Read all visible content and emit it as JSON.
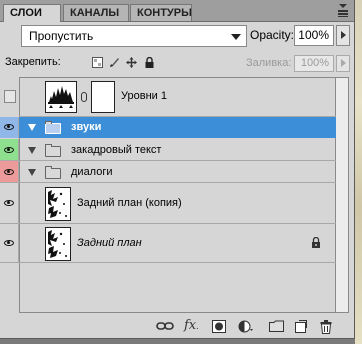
{
  "tabs": [
    {
      "label": "СЛОИ",
      "active": true
    },
    {
      "label": "КАНАЛЫ",
      "active": false
    },
    {
      "label": "КОНТУРЫ",
      "active": false
    }
  ],
  "blend": {
    "mode": "Пропустить",
    "opacity_label": "Opacity:",
    "opacity_value": "100%"
  },
  "lock": {
    "label": "Закрепить:",
    "fill_label": "Заливка:",
    "fill_value": "100%"
  },
  "layers": [
    {
      "name": "Уровни 1",
      "type": "adjustment",
      "visible": false
    },
    {
      "name": "звуки",
      "type": "group",
      "visible": true,
      "selected": true,
      "color": "#8fb8e8"
    },
    {
      "name": "закадровый текст",
      "type": "group",
      "visible": true,
      "color": "#8ee08e"
    },
    {
      "name": "диалоги",
      "type": "group",
      "visible": true,
      "color": "#ec9a9a"
    },
    {
      "name": "Задний план (копия)",
      "type": "image",
      "visible": true
    },
    {
      "name": "Задний план",
      "type": "background",
      "visible": true,
      "locked": true
    }
  ],
  "colors": {
    "selection": "#3c8ed8",
    "panel": "#d6d6d6"
  },
  "bottom_icons": [
    "link-layers-icon",
    "fx-icon",
    "add-mask-icon",
    "adjustment-layer-icon",
    "new-group-icon",
    "new-layer-icon",
    "delete-layer-icon"
  ]
}
